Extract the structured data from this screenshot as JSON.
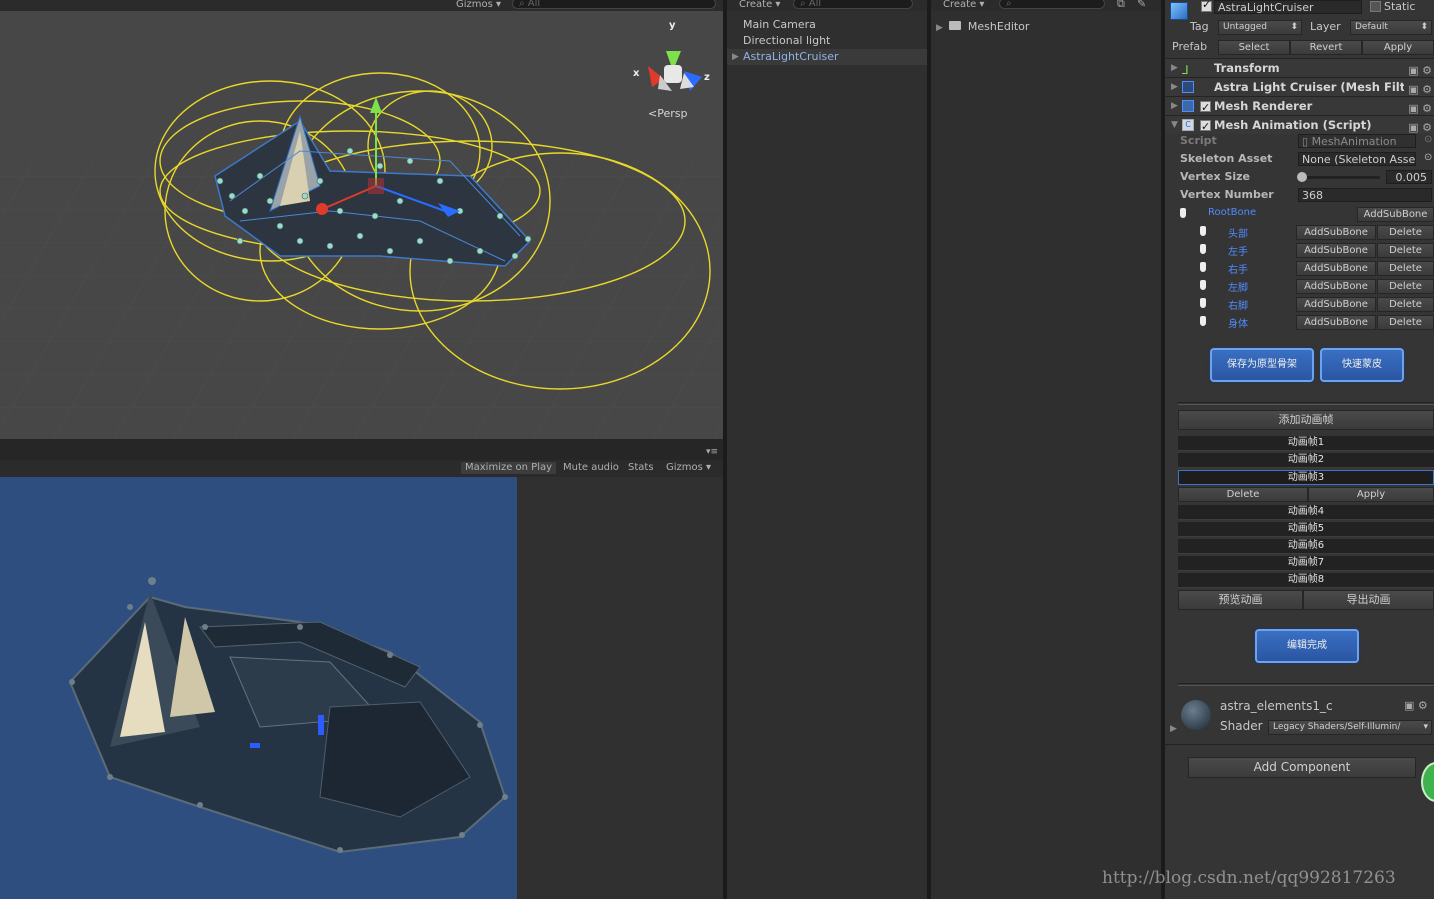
{
  "scene": {
    "gizmos_label": "Gizmos",
    "search_placeholder": "All",
    "persp_label": "Persp",
    "axis_x": "x",
    "axis_y": "y",
    "axis_z": "z"
  },
  "game": {
    "maximize_label": "Maximize on Play",
    "mute_label": "Mute audio",
    "stats_label": "Stats",
    "gizmos_label": "Gizmos"
  },
  "hierarchy": {
    "create_label": "Create",
    "search_placeholder": "All",
    "items": [
      {
        "label": "Main Camera"
      },
      {
        "label": "Directional light"
      },
      {
        "label": "AstraLightCruiser"
      }
    ]
  },
  "project": {
    "create_label": "Create",
    "folder_label": "MeshEditor"
  },
  "inspector": {
    "object_name": "AstraLightCruiser",
    "static_label": "Static",
    "tag_label": "Tag",
    "tag_value": "Untagged",
    "layer_label": "Layer",
    "layer_value": "Default",
    "prefab_label": "Prefab",
    "prefab_select": "Select",
    "prefab_revert": "Revert",
    "prefab_apply": "Apply",
    "components": [
      {
        "title": "Transform"
      },
      {
        "title": "Astra Light Cruiser (Mesh Filter)"
      },
      {
        "title": "Mesh Renderer"
      },
      {
        "title": "Mesh Animation (Script)"
      }
    ],
    "script_label": "Script",
    "script_value": "MeshAnimation",
    "skeleton_label": "Skeleton Asset",
    "skeleton_value": "None (Skeleton Asset)",
    "vertex_size_label": "Vertex Size",
    "vertex_size_value": "0.005",
    "vertex_number_label": "Vertex Number",
    "vertex_number_value": "368",
    "root_bone": "RootBone",
    "add_sub_bone": "AddSubBone",
    "delete_label": "Delete",
    "bones": [
      "头部",
      "左手",
      "右手",
      "左脚",
      "右脚",
      "身体"
    ],
    "save_skeleton": "保存为原型骨架",
    "quick_skin": "快速蒙皮",
    "add_frame": "添加动画帧",
    "frames": [
      "动画帧1",
      "动画帧2",
      "动画帧3",
      "动画帧4",
      "动画帧5",
      "动画帧6",
      "动画帧7",
      "动画帧8"
    ],
    "frame_delete": "Delete",
    "frame_apply": "Apply",
    "preview_anim": "预览动画",
    "export_anim": "导出动画",
    "edit_done": "编辑完成",
    "material_name": "astra_elements1_c",
    "shader_label": "Shader",
    "shader_value": "Legacy Shaders/Self-Illumin/",
    "add_component": "Add Component"
  },
  "watermark": "http://blog.csdn.net/qq992817263"
}
